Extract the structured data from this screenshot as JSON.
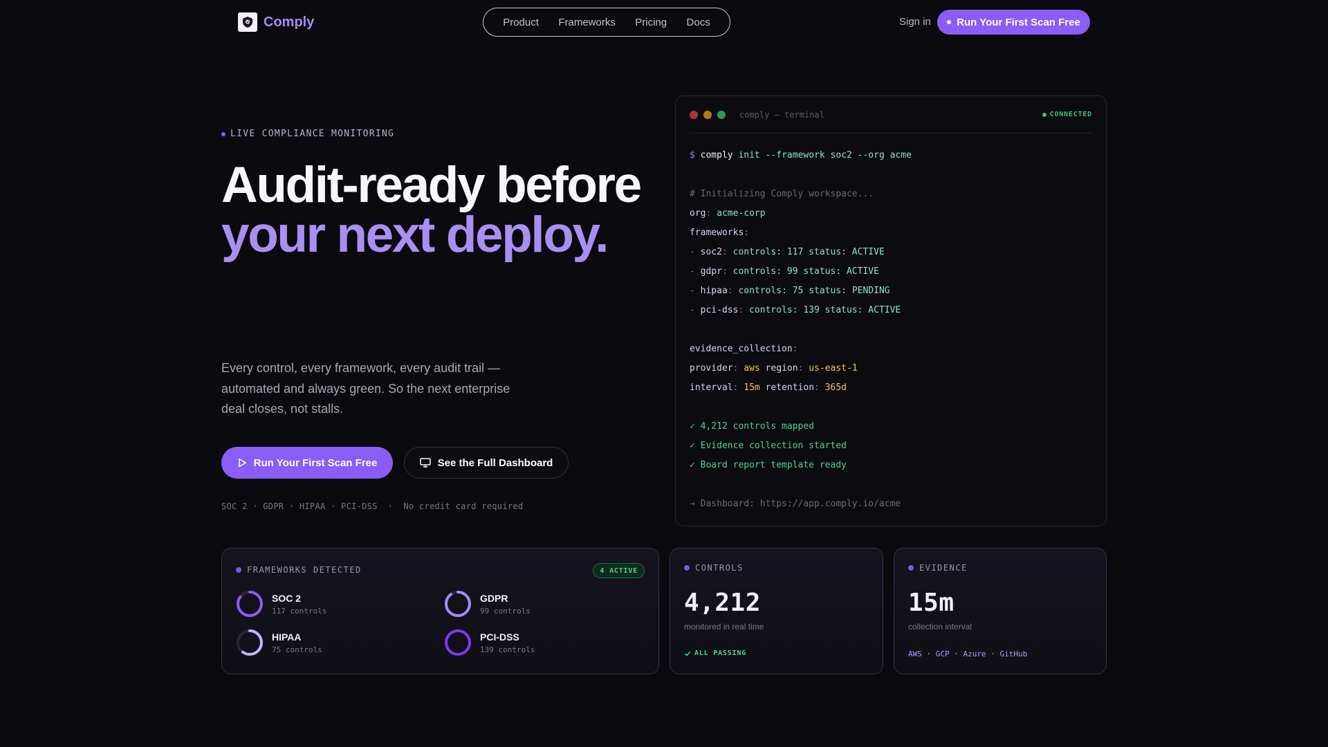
{
  "nav": {
    "brand": "Comply",
    "links": [
      "Product",
      "Frameworks",
      "Pricing",
      "Docs"
    ],
    "signin": "Sign in",
    "cta": "Run Your First Scan Free"
  },
  "hero": {
    "eyebrow": "LIVE COMPLIANCE MONITORING",
    "headline_line1": "Audit-ready before",
    "headline_line2": "your next deploy.",
    "lede": "Every control, every framework, every audit trail — automated and always green. So the next enterprise deal closes, not stalls.",
    "primary_cta": "Run Your First Scan Free",
    "secondary_cta": "See the Full Dashboard",
    "meta": "SOC 2 · GDPR · HIPAA · PCI-DSS  ·  No credit card required"
  },
  "terminal": {
    "title": "comply — terminal",
    "status": "CONNECTED",
    "lines": {
      "cmd": "comply",
      "cmd_args": " init --framework soc2 --org acme",
      "comment": "# Initializing Comply workspace...",
      "org_key": "org",
      "org_val": "acme-corp",
      "frameworks_key": "frameworks",
      "fw1_name": "soc2",
      "fw1_rest": "controls: 117 status: ACTIVE",
      "fw2_name": "gdpr",
      "fw2_rest": "controls: 99 status: ACTIVE",
      "fw3_name": "hipaa",
      "fw3_rest": "controls: 75 status: PENDING",
      "fw4_name": "pci-dss",
      "fw4_rest": "controls: 139 status: ACTIVE",
      "evidence_key": "evidence_collection",
      "provider_key": "provider",
      "provider_val": "aws",
      "region_key": "region",
      "region_val": "us-east-1",
      "interval_key": "interval",
      "interval_val": "15m",
      "retention_key": "retention",
      "retention_val": "365d",
      "ok1": "✓ 4,212 controls mapped",
      "ok2": "✓ Evidence collection started",
      "ok3": "✓ Board report template ready",
      "dashboard": "→ Dashboard: https://app.comply.io/acme"
    }
  },
  "cards": {
    "frameworks": {
      "label": "FRAMEWORKS DETECTED",
      "badge": "4 ACTIVE",
      "items": [
        {
          "name": "SOC 2",
          "sub": "117 controls",
          "progress": 0.85,
          "color": "#8b5cf6"
        },
        {
          "name": "GDPR",
          "sub": "99 controls",
          "progress": 0.9,
          "color": "#a78bfa"
        },
        {
          "name": "HIPAA",
          "sub": "75 controls",
          "progress": 0.6,
          "color": "#c4b5fd"
        },
        {
          "name": "PCI-DSS",
          "sub": "139 controls",
          "progress": 1.0,
          "color": "#7c3aed"
        }
      ]
    },
    "controls": {
      "label": "CONTROLS",
      "value": "4,212",
      "sub": "monitored in real time",
      "status": "ALL PASSING"
    },
    "evidence": {
      "label": "EVIDENCE",
      "value": "15m",
      "sub": "collection interval",
      "providers": "AWS · GCP · Azure · GitHub"
    }
  }
}
